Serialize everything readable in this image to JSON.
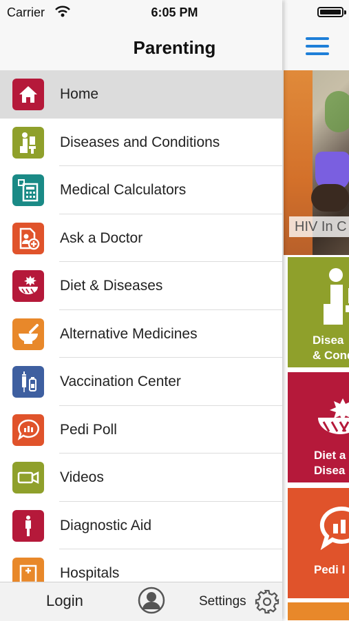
{
  "status_bar": {
    "carrier": "Carrier",
    "time": "6:05 PM"
  },
  "nav": {
    "title": "Parenting"
  },
  "menu": {
    "items": [
      {
        "label": "Home",
        "icon": "home-icon",
        "color": "#b5193a",
        "active": true
      },
      {
        "label": "Diseases and Conditions",
        "icon": "patient-doctor-icon",
        "color": "#8fa02b"
      },
      {
        "label": "Medical Calculators",
        "icon": "calculator-icon",
        "color": "#1a8a86"
      },
      {
        "label": "Ask a Doctor",
        "icon": "ask-doctor-icon",
        "color": "#e0532b"
      },
      {
        "label": "Diet & Diseases",
        "icon": "diet-bowl-icon",
        "color": "#b5193a"
      },
      {
        "label": "Alternative Medicines",
        "icon": "mortar-pestle-icon",
        "color": "#e8882a"
      },
      {
        "label": "Vaccination Center",
        "icon": "syringe-icon",
        "color": "#3e5fa0"
      },
      {
        "label": "Pedi Poll",
        "icon": "poll-bubble-icon",
        "color": "#e0532b"
      },
      {
        "label": "Videos",
        "icon": "video-camera-icon",
        "color": "#8fa02b"
      },
      {
        "label": "Diagnostic Aid",
        "icon": "body-figure-icon",
        "color": "#b5193a"
      },
      {
        "label": "Hospitals",
        "icon": "hospital-icon",
        "color": "#e8882a"
      }
    ]
  },
  "bottom_bar": {
    "login": "Login",
    "settings": "Settings"
  },
  "home_behind": {
    "banner_caption": "HIV In C",
    "tiles": [
      {
        "label": "Disea\n& Cond",
        "color": "#8fa02b",
        "icon": "patient-doctor-icon"
      },
      {
        "label": "Diet a\nDisea",
        "color": "#b5193a",
        "icon": "diet-bowl-icon"
      },
      {
        "label": "Pedi I",
        "color": "#e0532b",
        "icon": "poll-bubble-icon"
      }
    ]
  },
  "colors": {
    "accent": "#1e7fd8",
    "active_row": "#dcdcdc"
  }
}
